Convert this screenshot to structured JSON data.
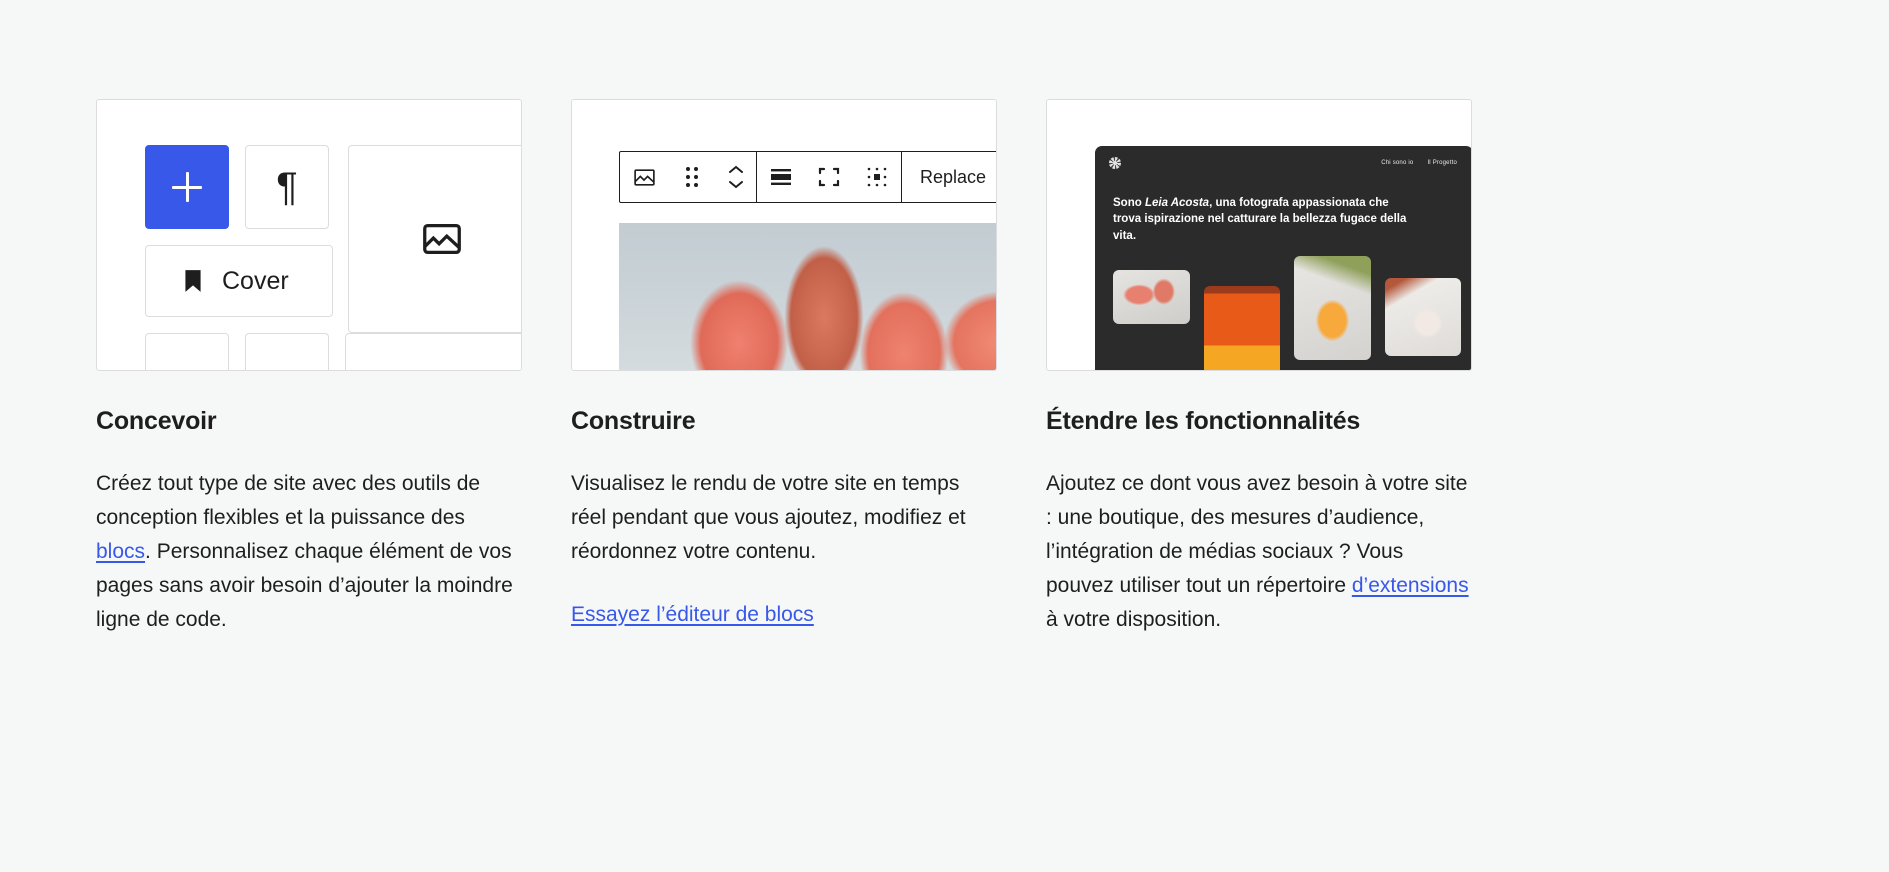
{
  "columns": [
    {
      "id": "design",
      "heading": "Concevoir",
      "body_before": "Créez tout type de site avec des outils de conception flexibles et la puissance des ",
      "body_link": "blocs",
      "body_after": ". Personnalisez chaque élément de vos pages sans avoir besoin d’ajouter la moindre ligne de code.",
      "media": {
        "type": "block-inserter",
        "add_button_label": "+",
        "paragraph_tile_label": "¶",
        "cover_tile_label": "Cover",
        "accent_color": "#3858e9",
        "tile_border_color": "#dcdcde"
      }
    },
    {
      "id": "build",
      "heading": "Construire",
      "body": "Visualisez le rendu de votre site en temps réel pendant que vous ajoutez, modifiez et réordonnez votre contenu.",
      "link_label": "Essayez l’éditeur de blocs",
      "media": {
        "type": "block-toolbar",
        "toolbar_buttons": [
          {
            "name": "image-icon",
            "label": ""
          },
          {
            "name": "drag-handle-icon",
            "label": ""
          },
          {
            "name": "move-up-down-icon",
            "label": ""
          },
          {
            "name": "align-icon",
            "label": ""
          },
          {
            "name": "full-width-icon",
            "label": ""
          },
          {
            "name": "crop-icon",
            "label": ""
          },
          {
            "name": "replace-button",
            "label": "Replace"
          },
          {
            "name": "more-options-icon",
            "label": ""
          }
        ],
        "toolbar_border_color": "#1e1e1e"
      }
    },
    {
      "id": "extend",
      "heading": "Étendre les fonctionnalités",
      "body_before": "Ajoutez ce dont vous avez besoin à votre site : une boutique, des mesures d’audience, l’intégration de médias sociaux ? Vous pouvez utiliser tout un répertoire ",
      "body_link": "d’extensions",
      "body_after": " à votre disposition.",
      "media": {
        "type": "site-preview",
        "background_color": "#2b2b2b",
        "nav_items": [
          "Chi sono io",
          "Il Progetto"
        ],
        "lead_prefix": "Sono ",
        "lead_name": "Leia Acosta",
        "lead_rest": ", una fotografa appassionata che trova ispirazione nel catturare la bellezza fugace della vita."
      }
    }
  ],
  "page": {
    "background_color": "#f6f7f7",
    "text_color": "#1e1e1e",
    "link_color": "#3858e9"
  }
}
